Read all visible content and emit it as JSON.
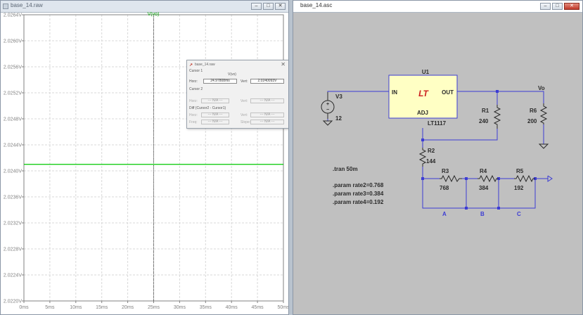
{
  "waveform": {
    "title": "base_14.raw",
    "trace_label": "V(vo)",
    "window_buttons": [
      "–",
      "□",
      "✕"
    ]
  },
  "schematic": {
    "title": "base_14.asc",
    "window_buttons": [
      "–",
      "□",
      "✕"
    ],
    "part": "U1",
    "part_name": "LT1117",
    "logo": "LT",
    "pin_in": "IN",
    "pin_out": "OUT",
    "pin_adj": "ADJ",
    "source_name": "V3",
    "source_value": "12",
    "r1_name": "R1",
    "r1_value": "240",
    "r2_name": "R2",
    "r2_value": "144",
    "r3_name": "R3",
    "r3_value": "768",
    "r4_name": "R4",
    "r4_value": "384",
    "r5_name": "R5",
    "r5_value": "192",
    "r6_name": "R6",
    "r6_value": "200",
    "net_vo": "Vo",
    "node_a": "A",
    "node_b": "B",
    "node_c": "C",
    "directives": [
      ".tran 50m",
      ".param rate2=0.768",
      ".param rate3=0.384",
      ".param rate4=0.192"
    ],
    "colors": {
      "background": "#c0c0c0",
      "wire": "#3c3cd4",
      "component": "#2a2a2a",
      "ic_fill": "#ffffc4",
      "logo": "#cc2020"
    }
  },
  "cursor_dialog": {
    "title": "base_14.raw",
    "cursor1_label": "Cursor 1",
    "cursor1_trace": "V(vo)",
    "horz_label": "Horz:",
    "horz_value": "24.97808ms",
    "vert_label": "Vert:",
    "vert_value": "2.0240093V",
    "cursor2_label": "Cursor 2",
    "c2_horz_label": "Horz:",
    "c2_horz_value": "--- N/A ---",
    "c2_vert_label": "Vert:",
    "c2_vert_value": "--- N/A ---",
    "diff_label": "Diff (Cursor2 - Cursor1)",
    "diff_horz_label": "Horz:",
    "diff_horz_value": "--- N/A ---",
    "diff_vert_label": "Vert:",
    "diff_vert_value": "--- N/A ---",
    "freq_label": "Freq:",
    "freq_value": "--- N/A ---",
    "slope_label": "Slope:",
    "slope_value": "--- N/A ---"
  },
  "chart_data": {
    "type": "line",
    "title": "",
    "xlabel": "",
    "ylabel": "",
    "series": [
      {
        "name": "V(vo)",
        "color": "#00c800",
        "x": [
          0,
          50
        ],
        "y": [
          2.0241,
          2.0241
        ]
      }
    ],
    "x_ticks": [
      "0ms",
      "5ms",
      "10ms",
      "15ms",
      "20ms",
      "25ms",
      "30ms",
      "35ms",
      "40ms",
      "45ms",
      "50ms"
    ],
    "y_ticks": [
      "2.0264V",
      "2.0260V",
      "2.0256V",
      "2.0252V",
      "2.0248V",
      "2.0244V",
      "2.0240V",
      "2.0236V",
      "2.0232V",
      "2.0228V",
      "2.0224V",
      "2.0220V"
    ],
    "xlim": [
      0,
      50
    ],
    "ylim": [
      2.022,
      2.0264
    ],
    "grid": true,
    "cursor_x": 25,
    "grid_color": "#d8d8d8",
    "axis_color": "#808080"
  }
}
